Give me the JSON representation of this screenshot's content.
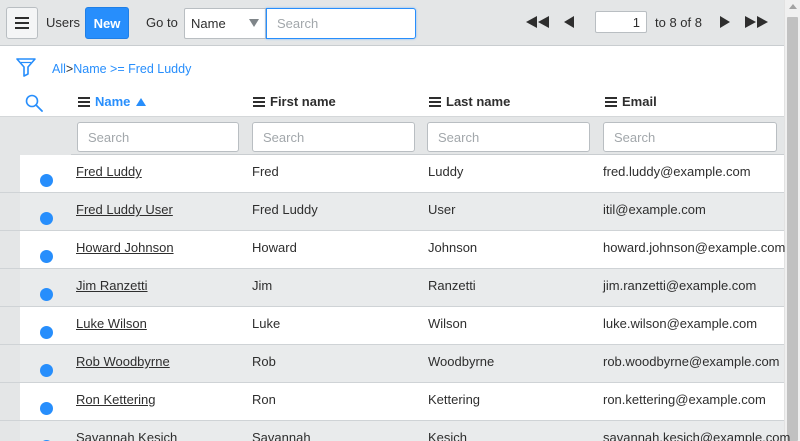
{
  "toolbar": {
    "title": "Users",
    "new_label": "New",
    "goto_label": "Go to",
    "goto_field": "Name",
    "search_placeholder": "Search",
    "page_current": "1",
    "page_of": "to 8 of 8"
  },
  "breadcrumb": {
    "all": "All",
    "separator": ">",
    "filter": "Name >= Fred Luddy"
  },
  "columns": [
    {
      "label": "Name",
      "sorted": "ascending"
    },
    {
      "label": "First name"
    },
    {
      "label": "Last name"
    },
    {
      "label": "Email"
    }
  ],
  "column_search_placeholder": "Search",
  "rows": [
    {
      "name": "Fred Luddy",
      "first": "Fred",
      "last": "Luddy",
      "email": "fred.luddy@example.com"
    },
    {
      "name": "Fred Luddy User",
      "first": "Fred Luddy",
      "last": "User",
      "email": "itil@example.com"
    },
    {
      "name": "Howard Johnson",
      "first": "Howard",
      "last": "Johnson",
      "email": "howard.johnson@example.com"
    },
    {
      "name": "Jim Ranzetti",
      "first": "Jim",
      "last": "Ranzetti",
      "email": "jim.ranzetti@example.com"
    },
    {
      "name": "Luke Wilson",
      "first": "Luke",
      "last": "Wilson",
      "email": "luke.wilson@example.com"
    },
    {
      "name": "Rob Woodbyrne",
      "first": "Rob",
      "last": "Woodbyrne",
      "email": "rob.woodbyrne@example.com"
    },
    {
      "name": "Ron Kettering",
      "first": "Ron",
      "last": "Kettering",
      "email": "ron.kettering@example.com"
    },
    {
      "name": "Savannah Kesich",
      "first": "Savannah",
      "last": "Kesich",
      "email": "savannah.kesich@example.com"
    }
  ],
  "icons": {
    "menu": "hamburger-icon",
    "filter": "funnel-icon",
    "search": "magnifier-icon",
    "first_page": "double-left-triangle-icon",
    "prev_page": "left-triangle-icon",
    "next_page": "right-triangle-icon",
    "last_page": "double-right-triangle-icon"
  },
  "colors": {
    "accent": "#278efc",
    "header_bg": "#e4e6e7",
    "alt_row_bg": "#e9ebec"
  }
}
